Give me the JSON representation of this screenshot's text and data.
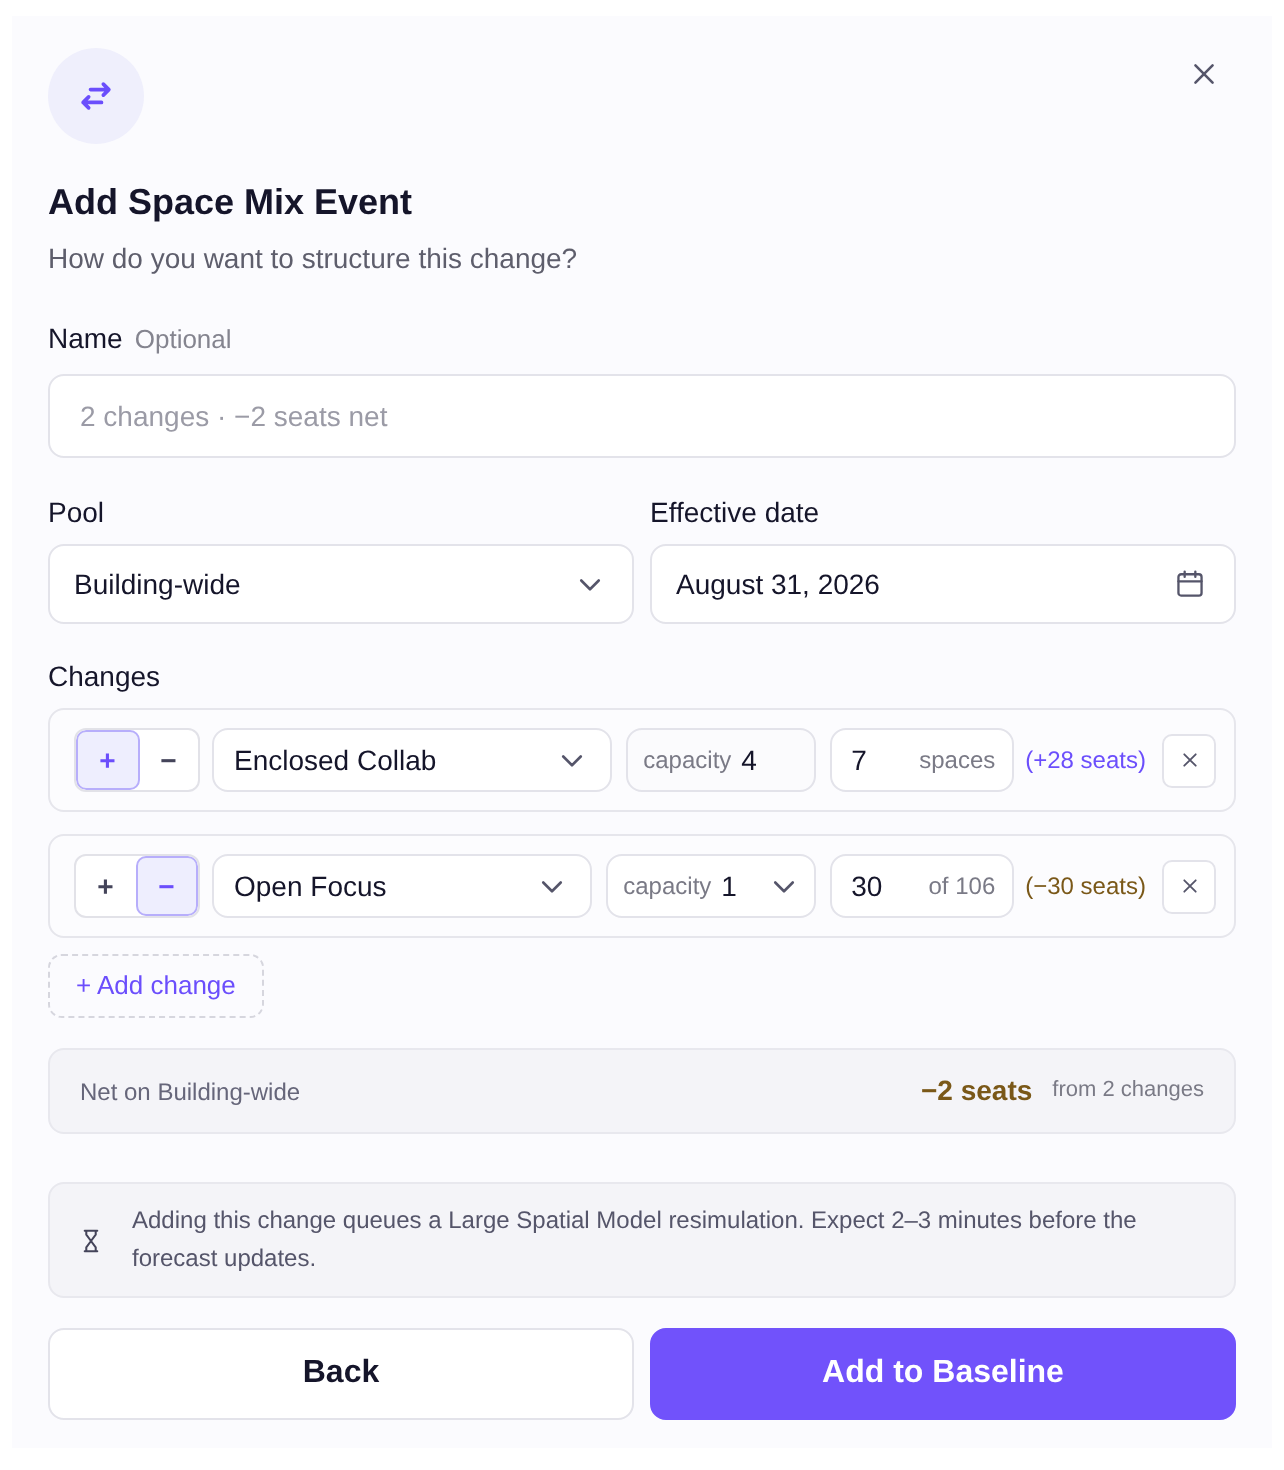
{
  "dialog": {
    "title": "Add Space Mix Event",
    "subtitle": "How do you want to structure this change?"
  },
  "name_field": {
    "label": "Name",
    "hint": "Optional",
    "placeholder": "2 changes · −2 seats net"
  },
  "pool": {
    "label": "Pool",
    "value": "Building-wide"
  },
  "effective_date": {
    "label": "Effective date",
    "value": "August 31, 2026"
  },
  "changes": {
    "label": "Changes",
    "items": [
      {
        "direction": [
          {
            "kind": "add",
            "label": "+",
            "selected": true
          },
          {
            "kind": "remove",
            "label": "−",
            "selected": false
          }
        ],
        "space_type": "Enclosed Collab",
        "capacity": {
          "kind": "fixed",
          "label": "capacity",
          "value": "4"
        },
        "count": {
          "value": "7",
          "suffix": "spaces"
        },
        "delta": "(+28 seats)"
      },
      {
        "direction": [
          {
            "kind": "add",
            "label": "+",
            "selected": false
          },
          {
            "kind": "remove",
            "label": "−",
            "selected": true
          }
        ],
        "space_type": "Open Focus",
        "capacity": {
          "kind": "select",
          "label": "capacity",
          "value": "1"
        },
        "count": {
          "value": "30",
          "suffix": "of 106"
        },
        "delta": "(−30 seats)"
      }
    ],
    "add_button": "+ Add change"
  },
  "net": {
    "label": "Net on Building-wide",
    "value": "−2 seats",
    "note": "from 2 changes"
  },
  "info": {
    "text": "Adding this change queues a Large Spatial Model resimulation. Expect 2–3 minutes before the forecast updates."
  },
  "buttons": [
    {
      "kind": "secondary",
      "label": "Back"
    },
    {
      "kind": "primary",
      "label": "Add to Baseline"
    }
  ]
}
